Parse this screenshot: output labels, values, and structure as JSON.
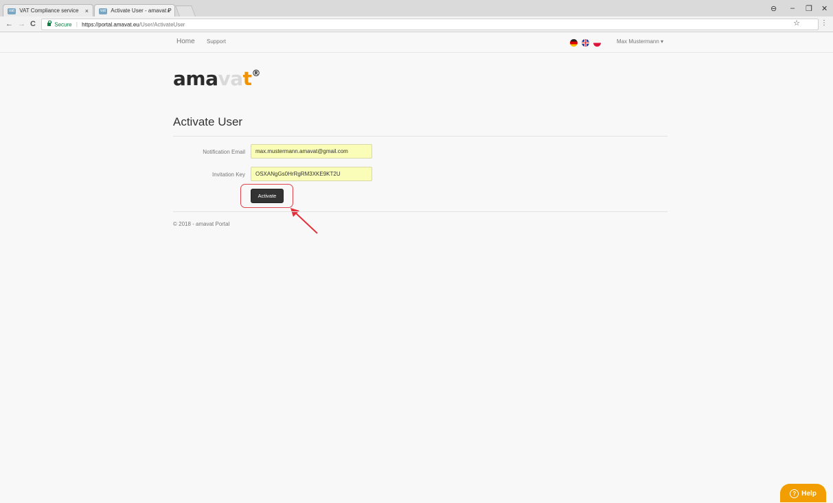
{
  "browser": {
    "tabs": [
      {
        "favicon": "vat",
        "title": "VAT Compliance service",
        "close": "×"
      },
      {
        "favicon": "vat",
        "title": "Activate User - amavat P",
        "close": "×"
      }
    ],
    "nav": {
      "back": "←",
      "forward": "→",
      "reload": "C"
    },
    "address": {
      "secure_label": "Secure",
      "separator": "|",
      "host": "https://portal.amavat.eu",
      "path": "/User/ActivateUser"
    },
    "icons": {
      "profile": "⊖",
      "minimize": "–",
      "restore": "❐",
      "close": "✕",
      "star": "☆",
      "menu": "⋮"
    }
  },
  "header": {
    "nav_home": "Home",
    "nav_support": "Support",
    "languages": [
      "de",
      "en",
      "pl"
    ],
    "user_name": "Max Mustermann",
    "user_caret": "▾"
  },
  "logo": {
    "part1": "ama",
    "part2": "va",
    "plus": "t",
    "reg": "®"
  },
  "form": {
    "title": "Activate User",
    "email_label": "Notification Email",
    "email_value": "max.mustermann.amavat@gmail.com",
    "key_label": "Invitation Key",
    "key_value": "OSXANgGs0HrRgRM3XKE9KT2U",
    "activate_label": "Activate"
  },
  "footer": {
    "text": "© 2018 - amavat Portal"
  },
  "help": {
    "icon": "?",
    "label": "Help"
  },
  "colors": {
    "accent": "#f29200",
    "button": "#333333",
    "field_bg": "#fafdb8",
    "highlight": "#e0414a"
  }
}
